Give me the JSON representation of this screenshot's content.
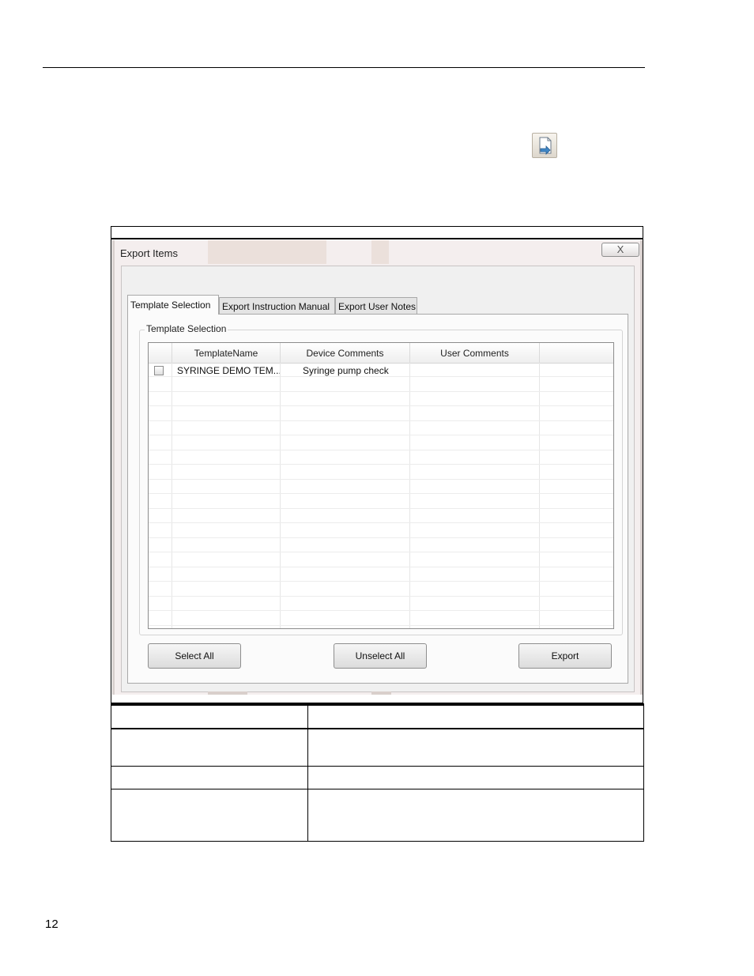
{
  "page": {
    "number": "12"
  },
  "dialog": {
    "title": "Export Items",
    "close_glyph": "X",
    "tabs": [
      {
        "label": "Template Selection",
        "active": true
      },
      {
        "label": "Export Instruction Manual",
        "active": false
      },
      {
        "label": "Export User Notes",
        "active": false
      }
    ],
    "group_label": "Template Selection",
    "grid": {
      "columns": [
        "TemplateName",
        "Device Comments",
        "User Comments"
      ],
      "rows": [
        {
          "checked": false,
          "template_name": "SYRINGE DEMO TEM...",
          "device_comments": "Syringe pump check",
          "user_comments": ""
        }
      ]
    },
    "buttons": {
      "select_all": "Select All",
      "unselect_all": "Unselect All",
      "export": "Export"
    }
  },
  "icons": {
    "export_icon": "export-document-icon",
    "checkbox": "checkbox-unchecked"
  }
}
